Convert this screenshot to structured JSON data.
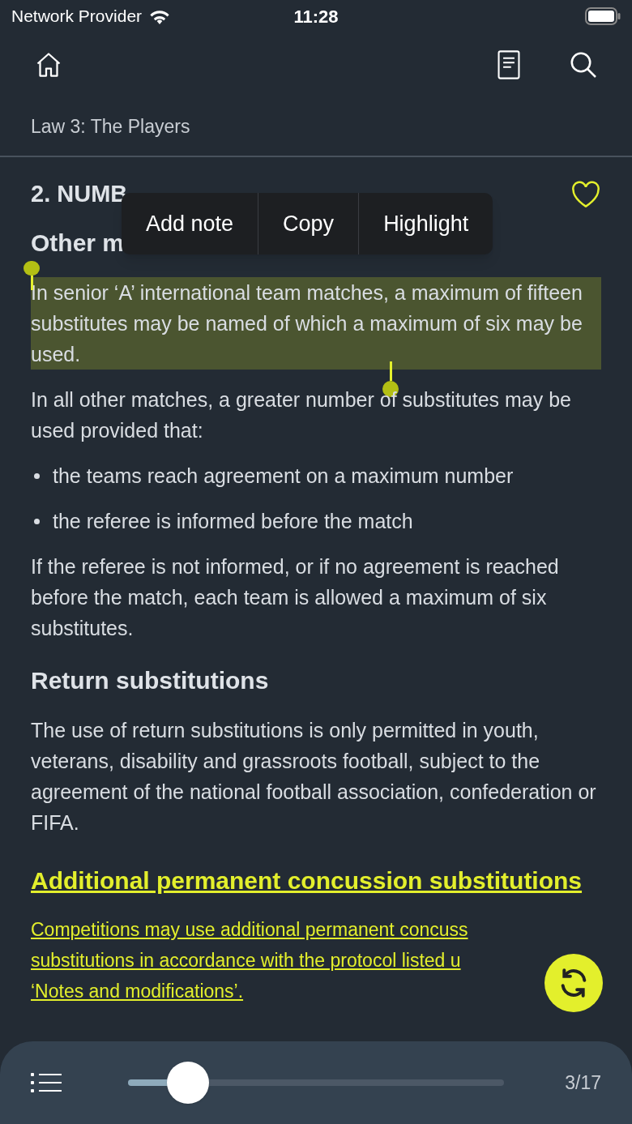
{
  "status_bar": {
    "carrier": "Network Provider",
    "time": "11:28"
  },
  "header": {
    "title": "Law 3: The Players"
  },
  "section": {
    "heading": "2. NUMB",
    "favorite": false
  },
  "context_menu": [
    "Add note",
    "Copy",
    "Highlight"
  ],
  "blocks": [
    {
      "kind": "subheading",
      "text": "Other m"
    },
    {
      "kind": "paragraph",
      "text": "In senior ‘A’ international team matches, a maximum of fifteen substitutes may be named of which a maximum of six may be used.",
      "selected": true
    },
    {
      "kind": "paragraph",
      "text": "In all other matches, a greater number of substitutes may be used provided that:",
      "selected": false
    },
    {
      "kind": "bullet",
      "text": "the teams reach agreement on a maximum number"
    },
    {
      "kind": "bullet",
      "text": "the referee is informed before the match"
    },
    {
      "kind": "paragraph",
      "text": "If the referee is not informed, or if no agreement is reached before the match, each team is allowed a maximum of six substitutes.",
      "selected": false
    },
    {
      "kind": "subheading",
      "text": "Return substitutions"
    },
    {
      "kind": "paragraph",
      "text": "The use of return substitutions is only permitted in youth, veterans, disability and grassroots football, subject to the agreement of the national football association, confederation or FIFA.",
      "selected": false
    },
    {
      "kind": "link_heading",
      "text": "Additional permanent concussion substitutions"
    },
    {
      "kind": "link_lines",
      "lines": [
        "Competitions may use additional permanent concuss",
        "substitutions in accordance with the protocol listed u",
        "‘Notes and modifications’."
      ]
    }
  ],
  "pager": {
    "level": 0.16,
    "page": "3/17"
  }
}
